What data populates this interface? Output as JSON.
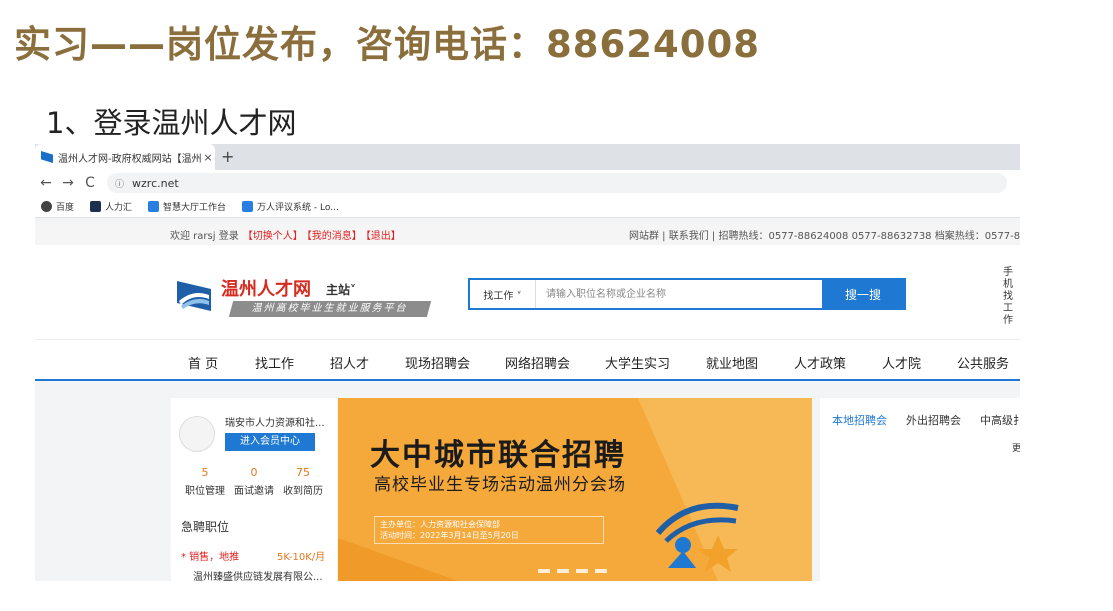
{
  "slide": {
    "title": "实习——岗位发布，咨询电话：88624008",
    "step": "1、登录温州人才网"
  },
  "browser": {
    "tab_title": "温州人才网-政府权威网站【温州",
    "tab_close": "×",
    "new_tab": "+",
    "back": "←",
    "forward": "→",
    "reload": "C",
    "url": "wzrc.net",
    "bookmarks": [
      {
        "label": "百度",
        "color": "#444444"
      },
      {
        "label": "人力汇",
        "color": "#1c2f4f"
      },
      {
        "label": "智慧大厅工作台",
        "color": "#2a7de1"
      },
      {
        "label": "万人评议系统 - Lo...",
        "color": "#2a7de1"
      }
    ]
  },
  "site": {
    "welcome": "欢迎 rarsj 登录",
    "switch_user": "【切换个人】",
    "messages": "【我的消息】",
    "logout": "【退出】",
    "hotline": "网站群 | 联系我们 | 招聘热线：0577-88624008 0577-88632738 档案热线：0577-8",
    "logo_name": "温州人才网",
    "logo_station": "主站˅",
    "logo_sub": "温州高校毕业生就业服务平台",
    "search_category": "找工作 ˅",
    "search_placeholder": "请输入职位名称或企业名称",
    "search_button": "搜一搜",
    "mobile_job": "手机找工作",
    "nav": [
      "首 页",
      "找工作",
      "招人才",
      "现场招聘会",
      "网络招聘会",
      "大学生实习",
      "就业地图",
      "人才政策",
      "人才院",
      "公共服务"
    ],
    "member": {
      "company": "瑞安市人力资源和社...",
      "center_button": "进入会员中心",
      "stats": [
        {
          "num": "5",
          "label": "职位管理"
        },
        {
          "num": "0",
          "label": "面试邀请"
        },
        {
          "num": "75",
          "label": "收到简历"
        }
      ],
      "urgent_title": "急聘职位",
      "job": "* 销售，地推",
      "salary": "5K-10K/月",
      "job_company": "温州臻盛供应链发展有限公..."
    },
    "banner": {
      "headline": "大中城市联合招聘",
      "subline": "高校毕业生专场活动温州分会场",
      "organizer": "主办单位：人力资源和社会保障部",
      "period": "活动时间：2022年3月14日至5月20日"
    },
    "side_tabs": [
      "本地招聘会",
      "外出招聘会",
      "中高级扌"
    ],
    "side_more": "更"
  },
  "colors": {
    "title": "#8a6e3c",
    "brand_blue": "#1f78d1",
    "brand_red": "#d62b1f",
    "banner": "#f5a93a"
  }
}
